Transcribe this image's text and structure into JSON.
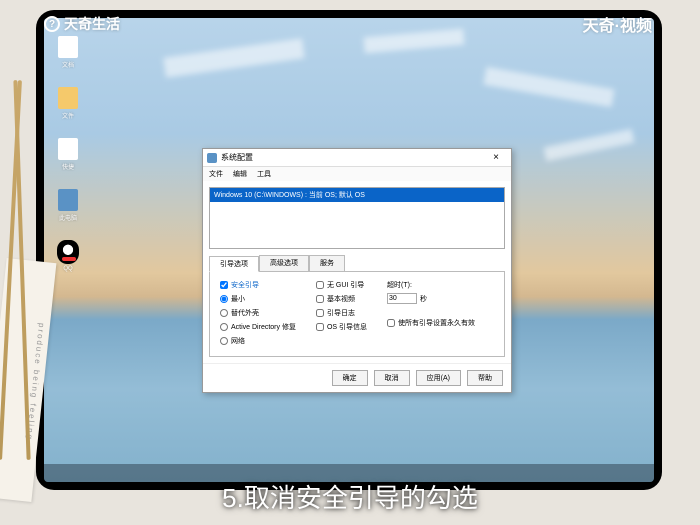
{
  "watermark": {
    "top_left": "天奇生活",
    "top_right": "天奇·视频"
  },
  "subtitle": "5.取消安全引导的勾选",
  "desktop": {
    "icons": [
      {
        "label": "文档"
      },
      {
        "label": "文件"
      },
      {
        "label": "快捷"
      },
      {
        "label": "此电脑"
      },
      {
        "label": "QQ"
      }
    ]
  },
  "dialog": {
    "title": "系统配置",
    "close": "×",
    "menu": [
      "文件",
      "编辑",
      "工具"
    ],
    "os_entry": "Windows 10 (C:\\WINDOWS) : 当前 OS; 默认 OS",
    "tabs": [
      "引导选项",
      "高级选项",
      "服务"
    ],
    "boot_options": {
      "safe_boot": "安全引导",
      "minimal": "最小",
      "alt_shell": "替代外壳",
      "ad_repair": "Active Directory 修复",
      "network": "网络",
      "no_gui": "无 GUI 引导",
      "boot_log": "基本视频",
      "base_video": "引导日志",
      "os_info": "OS 引导信息"
    },
    "timeout": {
      "label": "超时(T):",
      "value": "30",
      "unit": "秒"
    },
    "persist": "使所有引导设置永久有效",
    "buttons": {
      "ok": "确定",
      "cancel": "取消",
      "apply": "应用(A)",
      "help": "帮助"
    }
  },
  "tag_text": "produce being feeling"
}
